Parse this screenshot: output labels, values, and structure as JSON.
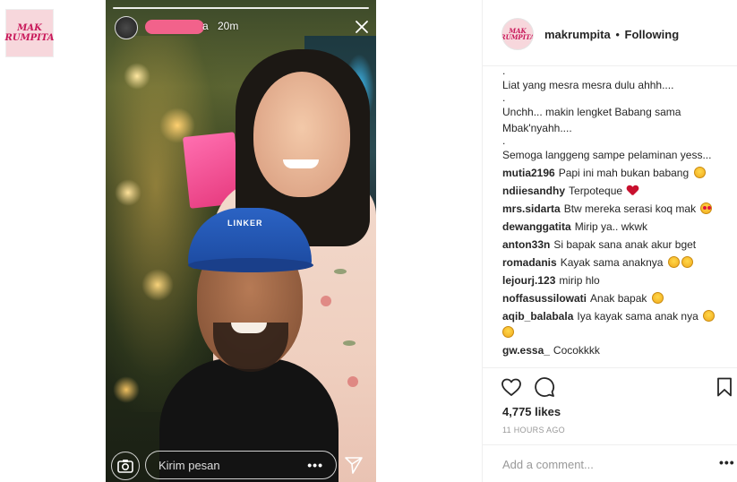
{
  "thumbnail": {
    "logo_text": "MAK\nRUMPITA"
  },
  "story": {
    "username_tail": "a",
    "time": "20m",
    "cap_text": "LINKER",
    "reply_placeholder": "Kirim pesan",
    "more_label": "•••",
    "icons": {
      "close": "close-icon",
      "camera": "camera-icon",
      "send": "send-icon"
    }
  },
  "post": {
    "avatar_text": "MAK\nRUMPITA",
    "username": "makrumpita",
    "separator": "•",
    "follow_status": "Following",
    "caption_lines": [
      ".",
      "Liat yang mesra mesra dulu ahhh....",
      ".",
      "Unchh... makin lengket Babang sama Mbak'nyahh....",
      ".",
      "Semoga langgeng sampe pelaminan yess..."
    ],
    "comments": [
      {
        "user": "mutia2196",
        "text": "Papi ini mah bukan babang",
        "emoji": [
          "grin"
        ]
      },
      {
        "user": "ndiiesandhy",
        "text": "Terpoteque",
        "emoji": [
          "heart"
        ]
      },
      {
        "user": "mrs.sidarta",
        "text": "Btw mereka serasi koq mak",
        "emoji": [
          "hearteyes"
        ]
      },
      {
        "user": "dewanggatita",
        "text": "Mirip ya.. wkwk",
        "emoji": []
      },
      {
        "user": "anton33n",
        "text": "Si bapak sana anak akur bget",
        "emoji": []
      },
      {
        "user": "romadanis",
        "text": "Kayak sama anaknya",
        "emoji": [
          "grin",
          "sad"
        ]
      },
      {
        "user": "lejourj.123",
        "text": "mirip hlo",
        "emoji": []
      },
      {
        "user": "noffasussilowati",
        "text": "Anak bapak",
        "emoji": [
          "grin"
        ]
      },
      {
        "user": "aqib_balabala",
        "text": "Iya kayak sama anak nya",
        "emoji": [
          "grin",
          "grin"
        ]
      },
      {
        "user": "gw.essa_",
        "text": "Cocokkkk",
        "emoji": []
      }
    ],
    "likes": "4,775 likes",
    "time_ago": "11 HOURS AGO",
    "add_comment_placeholder": "Add a comment...",
    "more_options": "•••",
    "icons": {
      "like": "heart-outline-icon",
      "comment": "comment-bubble-icon",
      "save": "bookmark-icon"
    }
  }
}
